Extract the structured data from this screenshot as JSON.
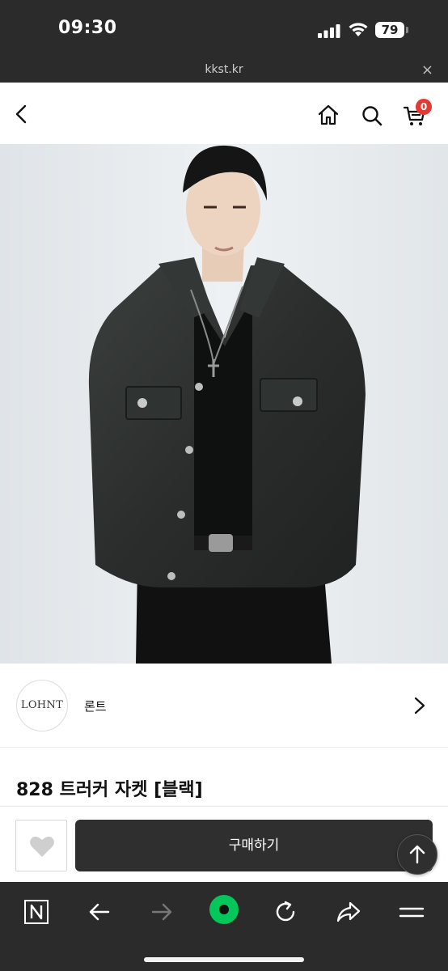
{
  "status_bar": {
    "time": "09:30",
    "battery": "79"
  },
  "url_bar": {
    "url": "kkst.kr",
    "close_glyph": "×"
  },
  "header": {
    "cart_count": "0",
    "icons": [
      "back-arrow-icon",
      "home-icon",
      "search-icon",
      "cart-icon"
    ]
  },
  "product": {
    "image_alt": "model wearing black leather trucker jacket",
    "title": "828 트러커 자켓 [블랙]"
  },
  "brand": {
    "logo_text": "LOHNT",
    "name": "론트"
  },
  "actions": {
    "buy_label": "구매하기",
    "wish_icon": "heart-icon",
    "scroll_top_icon": "arrow-up-icon"
  },
  "browser_toolbar": {
    "items": [
      "naver-n-icon",
      "back-icon",
      "forward-icon",
      "green-dot-icon",
      "reload-icon",
      "share-icon",
      "menu-icon"
    ]
  },
  "colors": {
    "status_bg": "#2b2b2b",
    "badge": "#e53935",
    "buy_button": "#2f2f2f",
    "green_accent": "#03c75a"
  }
}
